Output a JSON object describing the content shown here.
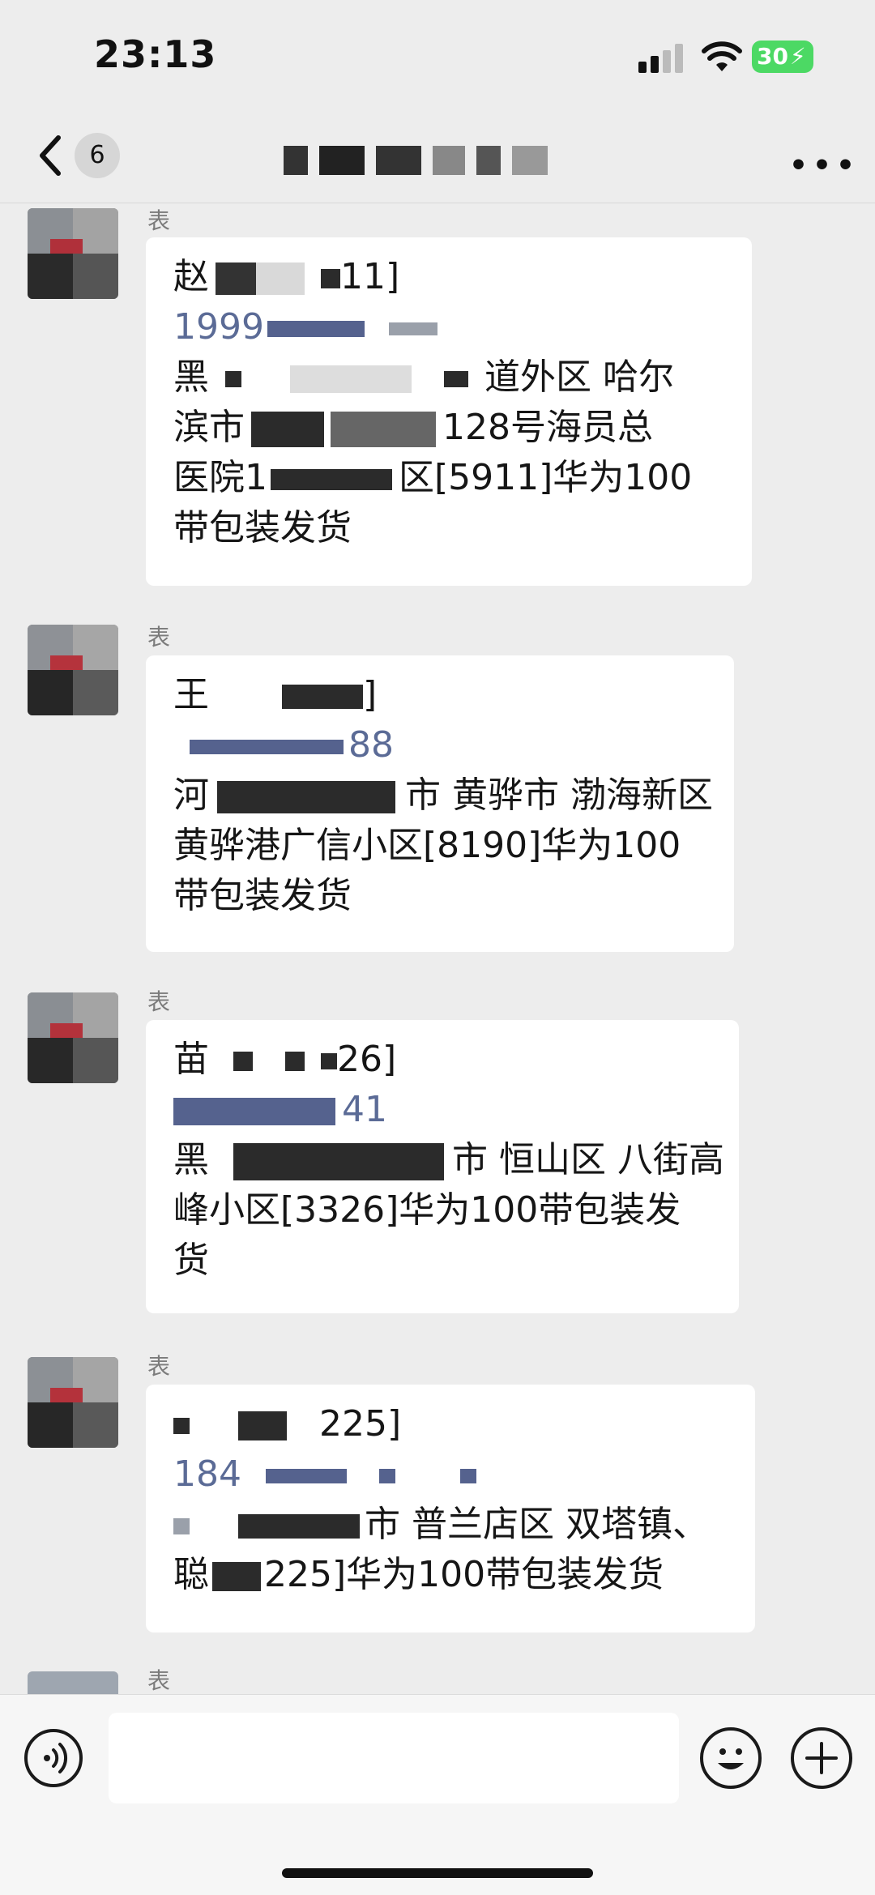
{
  "status_bar": {
    "time": "23:13",
    "battery": "30"
  },
  "nav": {
    "unread_count": "6"
  },
  "messages": [
    {
      "sender": "表",
      "lines": [
        {
          "text": "赵",
          "suffix": "11]"
        },
        {
          "text": "1999",
          "phone": true
        },
        {
          "text": "黑",
          "suffix": "道外区 哈尔"
        },
        {
          "text": "滨市",
          "suffix": "128号海员总"
        },
        {
          "text": "医院1",
          "suffix": "区[5911]华为100"
        },
        {
          "text": "带包装发货"
        }
      ]
    },
    {
      "sender": "表",
      "lines": [
        {
          "text": "王",
          "suffix": "]"
        },
        {
          "text": "",
          "suffix": "88",
          "phone": true
        },
        {
          "text": "河",
          "suffix": "市 黄骅市 渤海新区"
        },
        {
          "text": "黄骅港广信小区[8190]华为100"
        },
        {
          "text": "带包装发货"
        }
      ]
    },
    {
      "sender": "表",
      "lines": [
        {
          "text": "苗",
          "suffix": "26]"
        },
        {
          "text": "",
          "suffix": "41",
          "phone": true
        },
        {
          "text": "黑",
          "suffix": "市 恒山区 八街高"
        },
        {
          "text": "峰小区[3326]华为100带包装发"
        },
        {
          "text": "货"
        }
      ]
    },
    {
      "sender": "表",
      "lines": [
        {
          "text": "",
          "suffix": "225]"
        },
        {
          "text": "184",
          "phone": true
        },
        {
          "text": "",
          "suffix": "市 普兰店区 双塔镇、"
        },
        {
          "text": "聪",
          "suffix": "225]华为100带包装发货"
        }
      ]
    },
    {
      "sender": "表",
      "lines": []
    }
  ],
  "input": {
    "placeholder": ""
  },
  "icons": [
    "back-icon",
    "more-icon",
    "voice-icon",
    "emoji-icon",
    "plus-icon",
    "signal-icon",
    "wifi-icon"
  ]
}
